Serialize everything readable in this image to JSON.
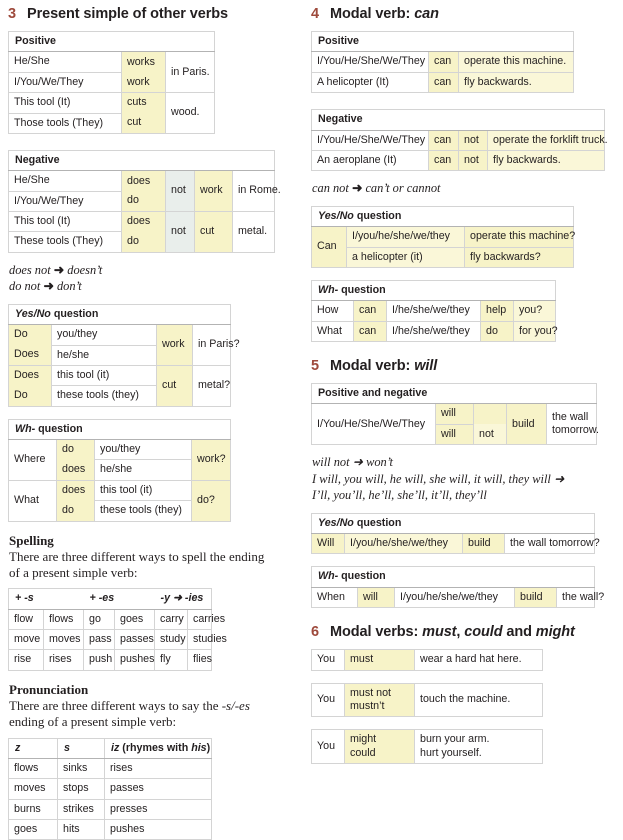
{
  "colors": {
    "section_number": "#9e4a3c",
    "highlight_yellow": "#f7f3c8",
    "highlight_grey": "#e9eeeb",
    "table_border": "#b3b3b3"
  },
  "arrow": "➜",
  "sections": {
    "s3": {
      "number": "3",
      "title": "Present simple of other verbs",
      "positive": {
        "header": "Positive",
        "rows": [
          {
            "subject": "He/She",
            "verb": "works",
            "object": "in Paris."
          },
          {
            "subject": "I/You/We/They",
            "verb": "work",
            "object": ""
          },
          {
            "subject": "This tool (It)",
            "verb": "cuts",
            "object": "wood."
          },
          {
            "subject": "Those tools (They)",
            "verb": "cut",
            "object": ""
          }
        ]
      },
      "negative": {
        "header": "Negative",
        "rows": [
          {
            "subject": "He/She",
            "aux": "does",
            "not": "not",
            "verb": "work",
            "object": "in Rome."
          },
          {
            "subject": "I/You/We/They",
            "aux": "do",
            "not": "",
            "verb": "",
            "object": ""
          },
          {
            "subject": "This tool (It)",
            "aux": "does",
            "not": "not",
            "verb": "cut",
            "object": "metal."
          },
          {
            "subject": "These tools (They)",
            "aux": "do",
            "not": "",
            "verb": "",
            "object": ""
          }
        ]
      },
      "notes": [
        {
          "from": "does not",
          "to": "doesn’t"
        },
        {
          "from": "do not",
          "to": "don’t"
        }
      ],
      "yesno": {
        "header_a": "Yes/No",
        "header_b": " question",
        "rows": [
          {
            "aux": "Do",
            "subject": "you/they",
            "verb": "work",
            "object": "in Paris?"
          },
          {
            "aux": "Does",
            "subject": "he/she",
            "verb": "",
            "object": ""
          },
          {
            "aux": "Does",
            "subject": "this tool (it)",
            "verb": "cut",
            "object": "metal?"
          },
          {
            "aux": "Do",
            "subject": "these tools (they)",
            "verb": "",
            "object": ""
          }
        ]
      },
      "wh": {
        "header_a": "Wh-",
        "header_b": " question",
        "rows": [
          {
            "wh": "Where",
            "aux": "do",
            "subject": "you/they",
            "verb": "work?"
          },
          {
            "wh": "",
            "aux": "does",
            "subject": "he/she",
            "verb": ""
          },
          {
            "wh": "What",
            "aux": "does",
            "subject": "this tool (it)",
            "verb": "do?"
          },
          {
            "wh": "",
            "aux": "do",
            "subject": "these tools (they)",
            "verb": ""
          }
        ]
      },
      "spelling": {
        "heading": "Spelling",
        "intro_line1": "There are three different ways to spell the ending",
        "intro_line2": "of a present simple verb:",
        "headers": [
          "+ -s",
          "+ -es",
          "-y ➜ -ies"
        ],
        "rows": [
          [
            "flow",
            "flows",
            "go",
            "goes",
            "carry",
            "carries"
          ],
          [
            "move",
            "moves",
            "pass",
            "passes",
            "study",
            "studies"
          ],
          [
            "rise",
            "rises",
            "push",
            "pushes",
            "fly",
            "flies"
          ]
        ]
      },
      "pronunciation": {
        "heading": "Pronunciation",
        "intro_line1_pre": "There are three different ways to say the ",
        "intro_line1_it": "-s/-es",
        "intro_line2": "ending of a present simple verb:",
        "headers": [
          "z",
          "s",
          "iz (rhymes with his)"
        ],
        "header3_pre": "iz",
        "header3_mid": " (rhymes with ",
        "header3_it": "his",
        "header3_post": ")",
        "rows": [
          [
            "flows",
            "sinks",
            "rises"
          ],
          [
            "moves",
            "stops",
            "passes"
          ],
          [
            "burns",
            "strikes",
            "presses"
          ],
          [
            "goes",
            "hits",
            "pushes"
          ]
        ]
      }
    },
    "s4": {
      "number": "4",
      "title_pre": "Modal verb: ",
      "title_it": "can",
      "positive": {
        "header": "Positive",
        "rows": [
          {
            "subject": "I/You/He/She/We/They",
            "modal": "can",
            "object": "operate this machine."
          },
          {
            "subject": "A helicopter (It)",
            "modal": "can",
            "object": "fly backwards."
          }
        ]
      },
      "negative": {
        "header": "Negative",
        "rows": [
          {
            "subject": "I/You/He/She/We/They",
            "modal": "can",
            "not": "not",
            "object": "operate the forklift truck."
          },
          {
            "subject": "An aeroplane (It)",
            "modal": "can",
            "not": "not",
            "object": "fly backwards."
          }
        ]
      },
      "note": {
        "from": "can not",
        "to": "can’t or cannot"
      },
      "yesno": {
        "header_a": "Yes/No",
        "header_b": " question",
        "modal": "Can",
        "rows": [
          {
            "subject": "I/you/he/she/we/they",
            "object": "operate this machine?"
          },
          {
            "subject": "a helicopter (it)",
            "object": "fly backwards?"
          }
        ]
      },
      "wh": {
        "header_a": "Wh-",
        "header_b": " question",
        "rows": [
          {
            "wh": "How",
            "modal": "can",
            "subject": "I/he/she/we/they",
            "verb": "help",
            "object": "you?"
          },
          {
            "wh": "What",
            "modal": "can",
            "subject": "I/he/she/we/they",
            "verb": "do",
            "object": "for you?"
          }
        ]
      }
    },
    "s5": {
      "number": "5",
      "title_pre": "Modal verb: ",
      "title_it": "will",
      "posneg": {
        "header": "Positive and negative",
        "subject": "I/You/He/She/We/They",
        "modal_1": "will",
        "modal_2": "will",
        "not": "not",
        "verb": "build",
        "object_line1": "the wall",
        "object_line2": "tomorrow."
      },
      "notes": [
        "will not ➜ won’t",
        "I will, you will, he will, she will, it will, they will ➜",
        "I’ll, you’ll, he’ll, she’ll, it’ll, they’ll"
      ],
      "yesno": {
        "header_a": "Yes/No",
        "header_b": " question",
        "row": {
          "modal": "Will",
          "subject": "I/you/he/she/we/they",
          "verb": "build",
          "object": "the wall tomorrow?"
        }
      },
      "wh": {
        "header_a": "Wh-",
        "header_b": " question",
        "row": {
          "wh": "When",
          "modal": "will",
          "subject": "I/you/he/she/we/they",
          "verb": "build",
          "object": "the wall?"
        }
      }
    },
    "s6": {
      "number": "6",
      "title_pre": "Modal verbs: ",
      "title_it1": "must",
      "title_mid": ", ",
      "title_it2": "could",
      "title_and": " and ",
      "title_it3": "might",
      "tables": [
        {
          "subject": "You",
          "modal_line1": "must",
          "modal_line2": "",
          "object_line1": "wear a hard hat here.",
          "object_line2": ""
        },
        {
          "subject": "You",
          "modal_line1": "must not",
          "modal_line2": "mustn’t",
          "object_line1": "touch the machine.",
          "object_line2": ""
        },
        {
          "subject": "You",
          "modal_line1": "might",
          "modal_line2": "could",
          "object_line1": "burn your arm.",
          "object_line2": "hurt yourself."
        }
      ]
    }
  }
}
